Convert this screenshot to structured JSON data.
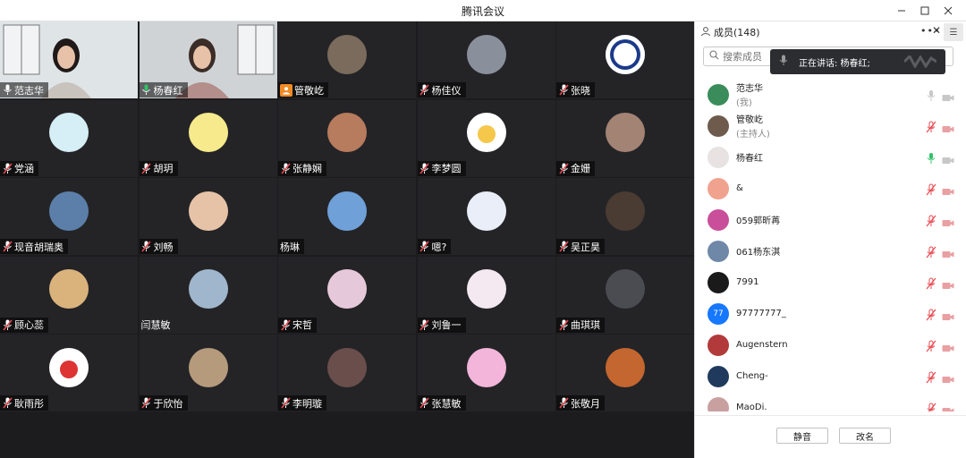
{
  "window": {
    "title": "腾讯会议",
    "minimize_icon": "minimize-icon",
    "maximize_icon": "maximize-icon",
    "close_icon": "close-icon"
  },
  "colors": {
    "stage_bg": "#1c1c1e",
    "tile_bg": "#242427",
    "speaking_border": "#31c26a",
    "muted_mic": "#e6484f",
    "host_badge": "#f08a24",
    "active_mic": "#31c26a"
  },
  "tiles": [
    {
      "name": "范志华",
      "mic": "on",
      "type": "video",
      "bg": "#4a4f57"
    },
    {
      "name": "杨春红",
      "mic": "active",
      "type": "video",
      "bg": "#3a3f46",
      "speaking": true
    },
    {
      "name": "管敬屹",
      "mic": "host",
      "type": "avatar",
      "avatar_color": "#7a6b5c"
    },
    {
      "name": "杨佳仪",
      "mic": "muted",
      "type": "avatar",
      "avatar_color": "#8a8f9c"
    },
    {
      "name": "张晓",
      "mic": "muted",
      "type": "avatar",
      "avatar_color": "#ffffff",
      "ring": "#1c3a8a"
    },
    {
      "name": "党涵",
      "mic": "muted",
      "type": "avatar",
      "avatar_color": "#d6eef5"
    },
    {
      "name": "胡玥",
      "mic": "muted",
      "type": "avatar",
      "avatar_color": "#f6ea8c"
    },
    {
      "name": "张静娴",
      "mic": "muted",
      "type": "avatar",
      "avatar_color": "#b77b5d"
    },
    {
      "name": "李梦圆",
      "mic": "muted",
      "type": "avatar",
      "avatar_color": "#ffffff",
      "accent": "#f5c74b"
    },
    {
      "name": "金姗",
      "mic": "muted",
      "type": "avatar",
      "avatar_color": "#a28374"
    },
    {
      "name": "现音胡瑞奥",
      "mic": "muted",
      "type": "avatar",
      "avatar_color": "#5b7fa8"
    },
    {
      "name": "刘畅",
      "mic": "muted",
      "type": "avatar",
      "avatar_color": "#e6c3a7"
    },
    {
      "name": "杨琳",
      "mic": "none",
      "type": "avatar",
      "avatar_color": "#6fa0d8"
    },
    {
      "name": "嗯?",
      "mic": "muted",
      "type": "avatar",
      "avatar_color": "#e9eef8"
    },
    {
      "name": "吴正昊",
      "mic": "muted",
      "type": "avatar",
      "avatar_color": "#4a3b33"
    },
    {
      "name": "顾心蕊",
      "mic": "muted",
      "type": "avatar",
      "avatar_color": "#d9b27c"
    },
    {
      "name": "闫慧敏",
      "mic": "none_plain",
      "type": "avatar",
      "avatar_color": "#9fb6cc"
    },
    {
      "name": "宋哲",
      "mic": "muted",
      "type": "avatar",
      "avatar_color": "#e5c8d9"
    },
    {
      "name": "刘鲁一",
      "mic": "muted",
      "type": "avatar",
      "avatar_color": "#f4e9f0"
    },
    {
      "name": "曲琪琪",
      "mic": "muted",
      "type": "avatar",
      "avatar_color": "#4b4b52"
    },
    {
      "name": "耿雨彤",
      "mic": "muted",
      "type": "avatar",
      "avatar_color": "#ffffff",
      "accent": "#d33"
    },
    {
      "name": "于欣怡",
      "mic": "muted",
      "type": "avatar",
      "avatar_color": "#b59a7c"
    },
    {
      "name": "李明璇",
      "mic": "muted",
      "type": "avatar",
      "avatar_color": "#6a4e4c"
    },
    {
      "name": "张慧敏",
      "mic": "muted",
      "type": "avatar",
      "avatar_color": "#f3b5d9"
    },
    {
      "name": "张敬月",
      "mic": "muted",
      "type": "avatar",
      "avatar_color": "#c4662f"
    }
  ],
  "sidebar": {
    "title": "成员(148)",
    "people_icon": "people-icon",
    "more_icon": "more-icon",
    "close_icon": "close-icon",
    "menu_icon": "menu-icon",
    "search_placeholder": "搜索成员",
    "toast_text": "正在讲话: 杨春红;",
    "members": [
      {
        "name": "范志华",
        "role": "(我)",
        "mic": "on",
        "cam": "off",
        "avatar_color": "#3a8c5a"
      },
      {
        "name": "管敬屹",
        "role": "(主持人)",
        "mic": "muted",
        "cam": "muted",
        "avatar_color": "#6e5b4c"
      },
      {
        "name": "杨春红",
        "role": "",
        "mic": "active",
        "cam": "off",
        "avatar_color": "#e8e2e2"
      },
      {
        "name": "&",
        "role": "",
        "mic": "muted",
        "cam": "muted",
        "avatar_color": "#f0a28f"
      },
      {
        "name": "059郭昕苒",
        "role": "",
        "mic": "muted",
        "cam": "muted",
        "avatar_color": "#c94f9a"
      },
      {
        "name": "061杨东淇",
        "role": "",
        "mic": "muted",
        "cam": "muted",
        "avatar_color": "#6f88a8"
      },
      {
        "name": "7991",
        "role": "",
        "mic": "muted",
        "cam": "muted",
        "avatar_color": "#1a1a1a"
      },
      {
        "name": "97777777_",
        "role": "",
        "mic": "muted",
        "cam": "muted",
        "avatar_color": "#1677ff",
        "initials": "77"
      },
      {
        "name": "Augenstern",
        "role": "",
        "mic": "muted",
        "cam": "muted",
        "avatar_color": "#b33a3a"
      },
      {
        "name": "Cheng-",
        "role": "",
        "mic": "muted",
        "cam": "muted",
        "avatar_color": "#1f3a5c"
      },
      {
        "name": "MaoDi.",
        "role": "",
        "mic": "muted",
        "cam": "muted",
        "avatar_color": "#c9a0a0"
      }
    ],
    "mute_all_label": "静音",
    "rename_label": "改名"
  }
}
